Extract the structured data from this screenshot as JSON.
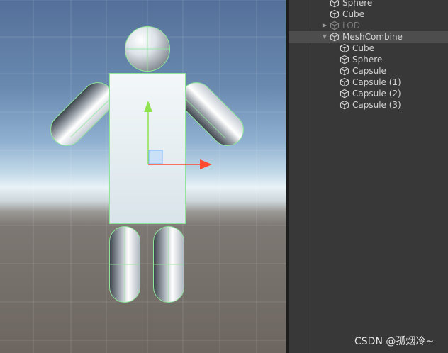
{
  "hierarchy": {
    "items": [
      {
        "label": "Sphere",
        "depth": 1,
        "expandable": false,
        "expanded": false,
        "disabled": false,
        "selected": false,
        "icon": "cube-icon"
      },
      {
        "label": "Cube",
        "depth": 1,
        "expandable": false,
        "expanded": false,
        "disabled": false,
        "selected": false,
        "icon": "cube-icon"
      },
      {
        "label": "LOD",
        "depth": 1,
        "expandable": true,
        "expanded": false,
        "disabled": true,
        "selected": false,
        "icon": "cube-icon"
      },
      {
        "label": "MeshCombine",
        "depth": 1,
        "expandable": true,
        "expanded": true,
        "disabled": false,
        "selected": true,
        "icon": "cube-icon"
      },
      {
        "label": "Cube",
        "depth": 2,
        "expandable": false,
        "expanded": false,
        "disabled": false,
        "selected": false,
        "icon": "cube-icon"
      },
      {
        "label": "Sphere",
        "depth": 2,
        "expandable": false,
        "expanded": false,
        "disabled": false,
        "selected": false,
        "icon": "cube-icon"
      },
      {
        "label": "Capsule",
        "depth": 2,
        "expandable": false,
        "expanded": false,
        "disabled": false,
        "selected": false,
        "icon": "cube-icon"
      },
      {
        "label": "Capsule (1)",
        "depth": 2,
        "expandable": false,
        "expanded": false,
        "disabled": false,
        "selected": false,
        "icon": "cube-icon"
      },
      {
        "label": "Capsule (2)",
        "depth": 2,
        "expandable": false,
        "expanded": false,
        "disabled": false,
        "selected": false,
        "icon": "cube-icon"
      },
      {
        "label": "Capsule (3)",
        "depth": 2,
        "expandable": false,
        "expanded": false,
        "disabled": false,
        "selected": false,
        "icon": "cube-icon"
      }
    ]
  },
  "scene": {
    "gizmo": {
      "x_axis_color": "#ff4a2d",
      "y_axis_color": "#8ee34e",
      "plane_handle_color": "#7fb8ff"
    },
    "selection_outline_color": "#8fe69a"
  },
  "watermark": "CSDN @孤烟冷~"
}
